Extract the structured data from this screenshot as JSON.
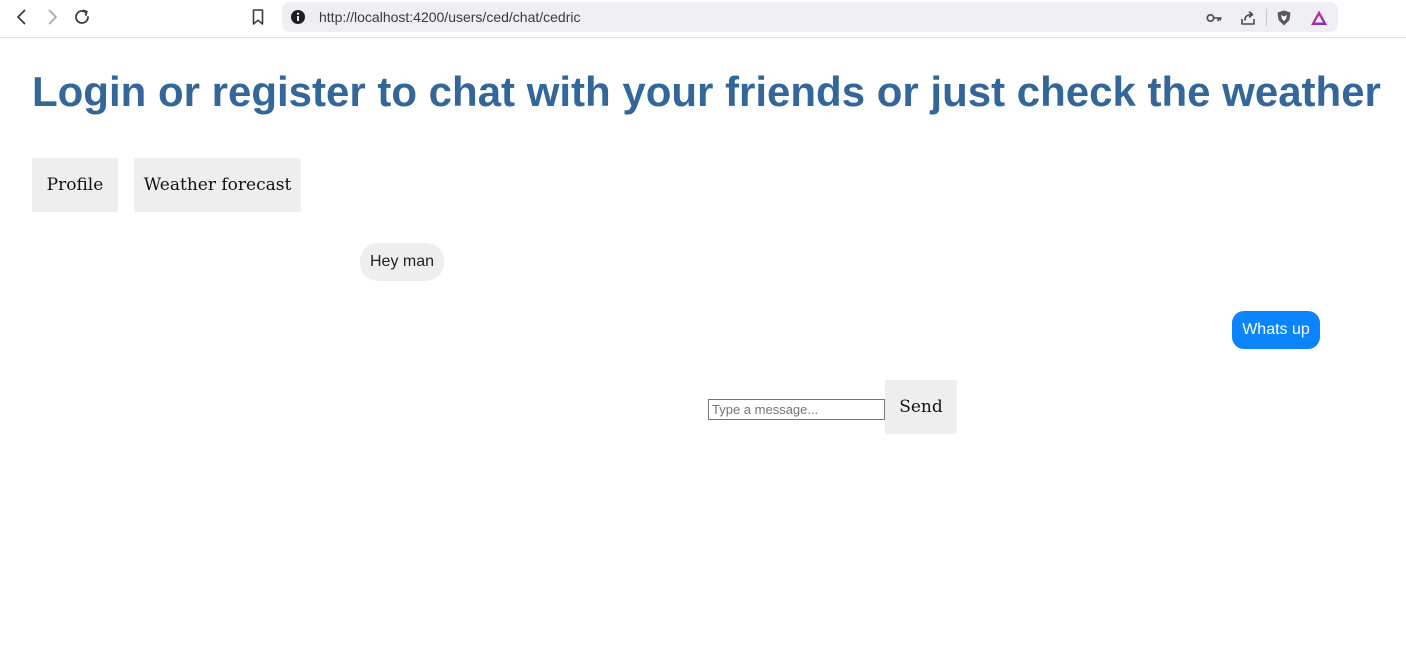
{
  "browser": {
    "url": "http://localhost:4200/users/ced/chat/cedric",
    "icons": {
      "back": "chevron-left-icon",
      "forward": "chevron-right-icon",
      "reload": "reload-icon",
      "bookmark": "bookmark-icon",
      "site_info": "info-icon",
      "password_key": "key-icon",
      "share": "share-icon",
      "brave_shield": "brave-shield-icon",
      "brave_rewards": "brave-rewards-icon"
    }
  },
  "page": {
    "title": "Login or register to chat with your friends or just check the weather",
    "title_color": "#336699"
  },
  "nav": {
    "profile_label": "Profile",
    "weather_label": "Weather forecast"
  },
  "chat": {
    "messages": [
      {
        "text": "Hey man",
        "direction": "received",
        "color": "#eeeeee"
      },
      {
        "text": "Whats up",
        "direction": "sent",
        "color": "#0a84ff"
      }
    ],
    "input_placeholder": "Type a message...",
    "input_value": "",
    "send_label": "Send"
  }
}
